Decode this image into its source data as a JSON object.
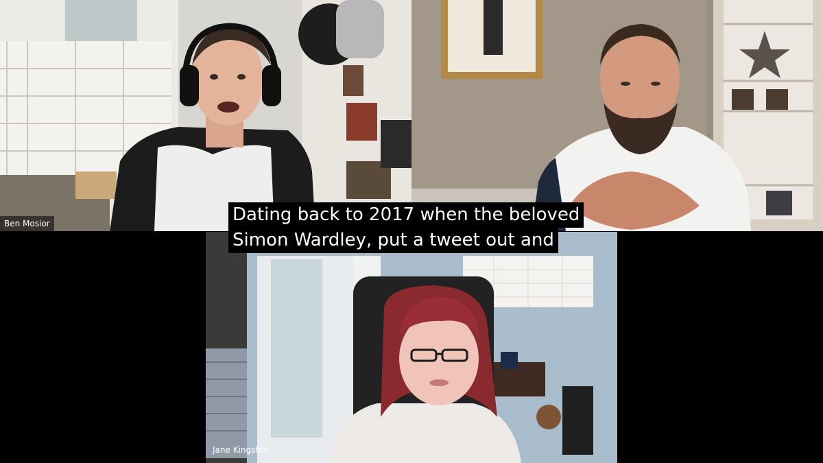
{
  "participants": [
    {
      "name": "Ben Mosior"
    },
    {
      "name": ""
    },
    {
      "name": "Jane Kingston"
    }
  ],
  "captions": {
    "line1": "Dating back to 2017 when the beloved",
    "line2": "Simon Wardley, put a tweet out and"
  }
}
